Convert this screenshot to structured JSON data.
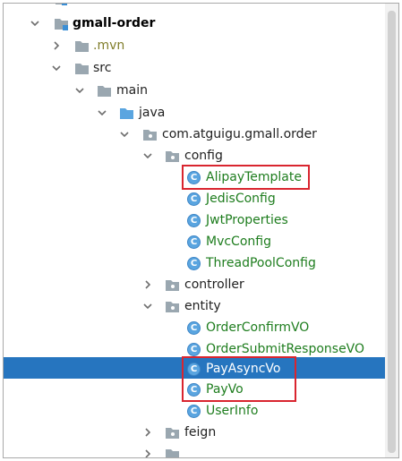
{
  "tree": {
    "project": "gmall-order",
    "mvn": ".mvn",
    "src": "src",
    "main": "main",
    "java": "java",
    "package": "com.atguigu.gmall.order",
    "config": "config",
    "config_classes": [
      "AlipayTemplate",
      "JedisConfig",
      "JwtProperties",
      "MvcConfig",
      "ThreadPoolConfig"
    ],
    "controller": "controller",
    "entity": "entity",
    "entity_classes": [
      "OrderConfirmVO",
      "OrderSubmitResponseVO",
      "PayAsyncVo",
      "PayVo",
      "UserInfo"
    ],
    "feign": "feign",
    "class_icon_letter": "C",
    "selected_item": "PayAsyncVo"
  },
  "colors": {
    "selection": "#2675bf",
    "highlight_box": "#d9252f",
    "class_name": "#1e7d1e",
    "class_icon": "#5aa5e0"
  }
}
